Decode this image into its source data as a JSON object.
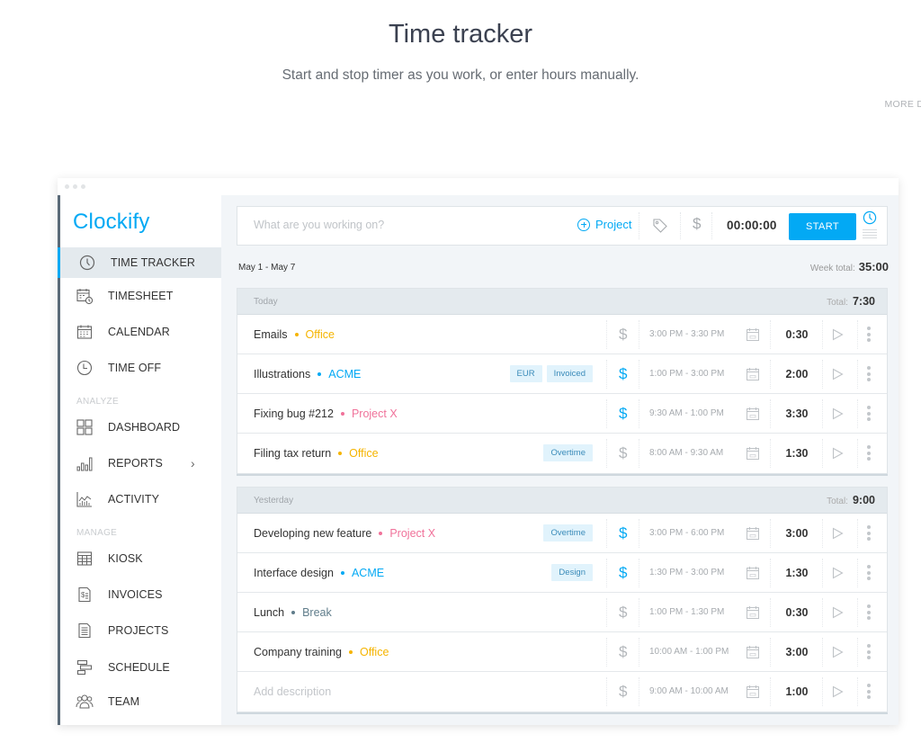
{
  "hero": {
    "title": "Time tracker",
    "subtitle": "Start and stop timer as you work, or enter hours manually.",
    "more_details": "MORE DETAILS"
  },
  "app": {
    "logo": "Clockify",
    "accent_color": "#03a9f4"
  },
  "sidebar": {
    "items": [
      {
        "label": "TIME TRACKER",
        "icon": "clock-icon",
        "active": true
      },
      {
        "label": "TIMESHEET",
        "icon": "timesheet-icon"
      },
      {
        "label": "CALENDAR",
        "icon": "calendar-icon"
      },
      {
        "label": "TIME OFF",
        "icon": "time-off-icon"
      },
      {
        "label": "DASHBOARD",
        "icon": "dashboard-icon"
      },
      {
        "label": "REPORTS",
        "icon": "reports-icon",
        "has_submenu": true
      },
      {
        "label": "ACTIVITY",
        "icon": "activity-icon"
      },
      {
        "label": "KIOSK",
        "icon": "kiosk-icon"
      },
      {
        "label": "INVOICES",
        "icon": "invoice-icon"
      },
      {
        "label": "PROJECTS",
        "icon": "projects-icon"
      },
      {
        "label": "SCHEDULE",
        "icon": "schedule-icon"
      },
      {
        "label": "TEAM",
        "icon": "team-icon"
      }
    ],
    "sections": {
      "analyze": "ANALYZE",
      "manage": "MANAGE"
    }
  },
  "tracker": {
    "placeholder": "What are you working on?",
    "project_label": "Project",
    "timer": "00:00:00",
    "start_label": "START"
  },
  "week": {
    "range": "May 1 - May 7",
    "total_label": "Week total:",
    "total": "35:00"
  },
  "days": [
    {
      "label": "Today",
      "total_label": "Total:",
      "total": "7:30",
      "entries": [
        {
          "description": "Emails",
          "project": "Office",
          "project_color": "#f5b400",
          "badges": [],
          "billable": false,
          "range": "3:00 PM - 3:30 PM",
          "duration": "0:30"
        },
        {
          "description": "Illustrations",
          "project": "ACME",
          "project_color": "#03a9f4",
          "badges": [
            "EUR",
            "Invoiced"
          ],
          "billable": true,
          "range": "1:00 PM - 3:00 PM",
          "duration": "2:00"
        },
        {
          "description": "Fixing bug #212",
          "project": "Project X",
          "project_color": "#f0729a",
          "badges": [],
          "billable": true,
          "range": "9:30 AM - 1:00 PM",
          "duration": "3:30"
        },
        {
          "description": "Filing tax return",
          "project": "Office",
          "project_color": "#f5b400",
          "badges": [
            "Overtime"
          ],
          "billable": false,
          "range": "8:00 AM - 9:30 AM",
          "duration": "1:30"
        }
      ]
    },
    {
      "label": "Yesterday",
      "total_label": "Total:",
      "total": "9:00",
      "entries": [
        {
          "description": "Developing new feature",
          "project": "Project X",
          "project_color": "#f0729a",
          "badges": [
            "Overtime"
          ],
          "billable": true,
          "range": "3:00 PM - 6:00 PM",
          "duration": "3:00"
        },
        {
          "description": "Interface design",
          "project": "ACME",
          "project_color": "#03a9f4",
          "badges": [
            "Design"
          ],
          "billable": true,
          "range": "1:30 PM - 3:00 PM",
          "duration": "1:30"
        },
        {
          "description": "Lunch",
          "project": "Break",
          "project_color": "#607d8b",
          "badges": [],
          "billable": false,
          "range": "1:00 PM - 1:30 PM",
          "duration": "0:30"
        },
        {
          "description": "Company training",
          "project": "Office",
          "project_color": "#f5b400",
          "badges": [],
          "billable": false,
          "range": "10:00 AM - 1:00 PM",
          "duration": "3:00"
        },
        {
          "description": "",
          "placeholder": "Add description",
          "project": "",
          "project_color": "",
          "badges": [],
          "billable": false,
          "range": "9:00 AM - 10:00 AM",
          "duration": "1:00"
        }
      ]
    }
  ]
}
